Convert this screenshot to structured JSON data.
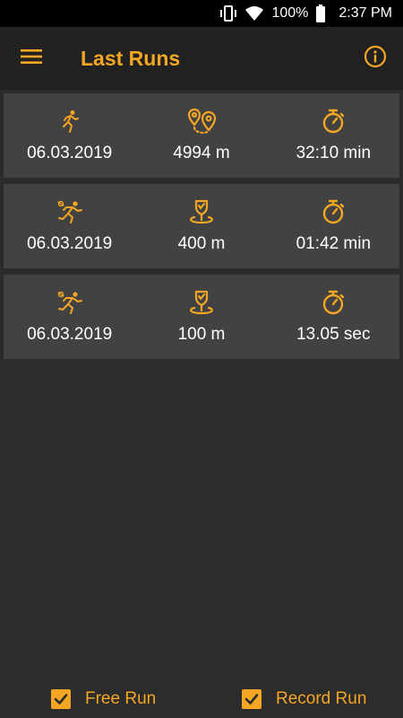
{
  "status_bar": {
    "battery_percent": "100%",
    "time": "2:37 PM"
  },
  "app_bar": {
    "title": "Last Runs",
    "menu_icon": "hamburger-menu-icon",
    "info_icon": "info-icon"
  },
  "colors": {
    "accent": "#f5a623",
    "background": "#2c2c2c",
    "card": "#424242",
    "app_bar": "#212121"
  },
  "runs": [
    {
      "type_icon": "runner-icon",
      "metric_icon": "route-pins-icon",
      "time_icon": "stopwatch-icon",
      "date": "06.03.2019",
      "distance": "4994 m",
      "time": "32:10 min"
    },
    {
      "type_icon": "sprinter-icon",
      "metric_icon": "trophy-pin-icon",
      "time_icon": "stopwatch-icon",
      "date": "06.03.2019",
      "distance": "400 m",
      "time": "01:42 min"
    },
    {
      "type_icon": "sprinter-icon",
      "metric_icon": "trophy-pin-icon",
      "time_icon": "stopwatch-icon",
      "date": "06.03.2019",
      "distance": "100 m",
      "time": "13.05 sec"
    }
  ],
  "footer": {
    "free_run_label": "Free Run",
    "free_run_checked": true,
    "record_run_label": "Record Run",
    "record_run_checked": true
  }
}
